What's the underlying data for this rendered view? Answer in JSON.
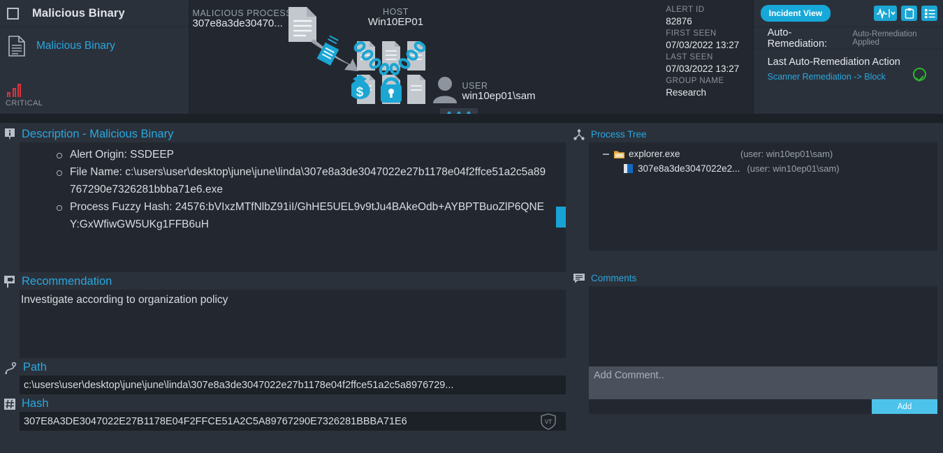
{
  "alert_card": {
    "title": "Malicious Binary",
    "link_label": "Malicious Binary",
    "severity": "CRITICAL",
    "severity_color": "#d9343f"
  },
  "graph": {
    "process_key": "MALICIOUS PROCESS",
    "process_value": "307e8a3de30470...",
    "host_key": "HOST",
    "host_value": "Win10EP01",
    "user_key": "USER",
    "user_value": "win10ep01\\sam"
  },
  "meta": {
    "alert_id_key": "ALERT ID",
    "alert_id_value": "82876",
    "first_seen_key": "FIRST SEEN",
    "first_seen_value": "07/03/2022 13:27",
    "last_seen_key": "LAST SEEN",
    "last_seen_value": "07/03/2022 13:27",
    "group_name_key": "GROUP NAME",
    "group_name_value": "Research"
  },
  "remediation": {
    "incident_view_label": "Incident View",
    "auto_remediation_label": "Auto-Remediation:",
    "auto_remediation_status": "Auto-Remediation Applied",
    "last_action_title": "Last Auto-Remediation Action",
    "last_action_value": "Scanner Remediation -> Block",
    "status_color": "#2db82d",
    "accent_color": "#16a8d8"
  },
  "description": {
    "title": "Description - Malicious Binary",
    "bullets": [
      "Alert Origin: SSDEEP",
      "File Name: c:\\users\\user\\desktop\\june\\june\\linda\\307e8a3de3047022e27b1178e04f2ffce51a2c5a89767290e7326281bbba71e6.exe",
      "Process Fuzzy Hash: 24576:bVIxzMTfNlbZ91iI/GhHE5UEL9v9tJu4BAkeOdb+AYBPTBuoZlP6QNEY:GxWfiwGW5UKg1FFB6uH"
    ]
  },
  "recommendation": {
    "title": "Recommendation",
    "text": "Investigate according to organization policy"
  },
  "path": {
    "title": "Path",
    "value": "c:\\users\\user\\desktop\\june\\june\\linda\\307e8a3de3047022e27b1178e04f2ffce51a2c5a8976729..."
  },
  "hash": {
    "title": "Hash",
    "value": "307E8A3DE3047022E27B1178E04F2FFCE51A2C5A89767290E7326281BBBA71E6",
    "vt_label": "VT"
  },
  "process_tree": {
    "title": "Process Tree",
    "nodes": [
      {
        "name": "explorer.exe",
        "user": "(user: win10ep01\\sam)"
      },
      {
        "name": "307e8a3de3047022e2...",
        "user": "(user: win10ep01\\sam)"
      }
    ]
  },
  "comments": {
    "title": "Comments",
    "placeholder": "Add Comment..",
    "value": "",
    "add_label": "Add"
  }
}
